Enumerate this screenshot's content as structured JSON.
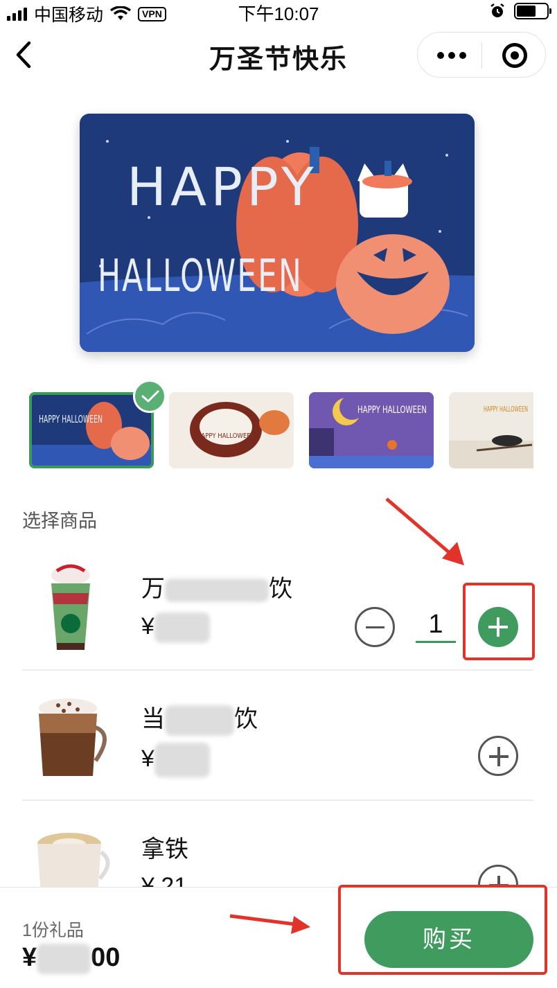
{
  "status_bar": {
    "carrier": "中国移动",
    "vpn": "VPN",
    "time": "下午10:07"
  },
  "nav": {
    "title": "万圣节快乐",
    "icons": [
      "back-chevron-icon",
      "more-dots-icon",
      "close-target-icon"
    ]
  },
  "card": {
    "line1": "HAPPY",
    "line2": "HALLOWEEN",
    "bg_color": "#1f3a7a"
  },
  "thumbnails": [
    {
      "text": "HAPPY HALLOWEEN",
      "selected": true
    },
    {
      "text": "HAPPY HALLOWEEN",
      "selected": false
    },
    {
      "text": "HAPPY HALLOWEEN",
      "selected": false
    },
    {
      "text": "HAPPY HALLOWEEN",
      "selected": false
    }
  ],
  "section_label": "选择商品",
  "products": [
    {
      "name_prefix": "万",
      "name_suffix": "饮",
      "price_prefix": "¥",
      "quantity": "1"
    },
    {
      "name_prefix": "当",
      "name_suffix": "饮",
      "price_prefix": "¥"
    },
    {
      "name": "拿铁",
      "price": "¥ 21"
    }
  ],
  "bottom": {
    "count_label": "1份礼品",
    "total_prefix": "¥",
    "total_suffix": "00",
    "buy_label": "购买"
  },
  "colors": {
    "accent": "#3f9b5e",
    "annotation_red": "#e2332b"
  }
}
